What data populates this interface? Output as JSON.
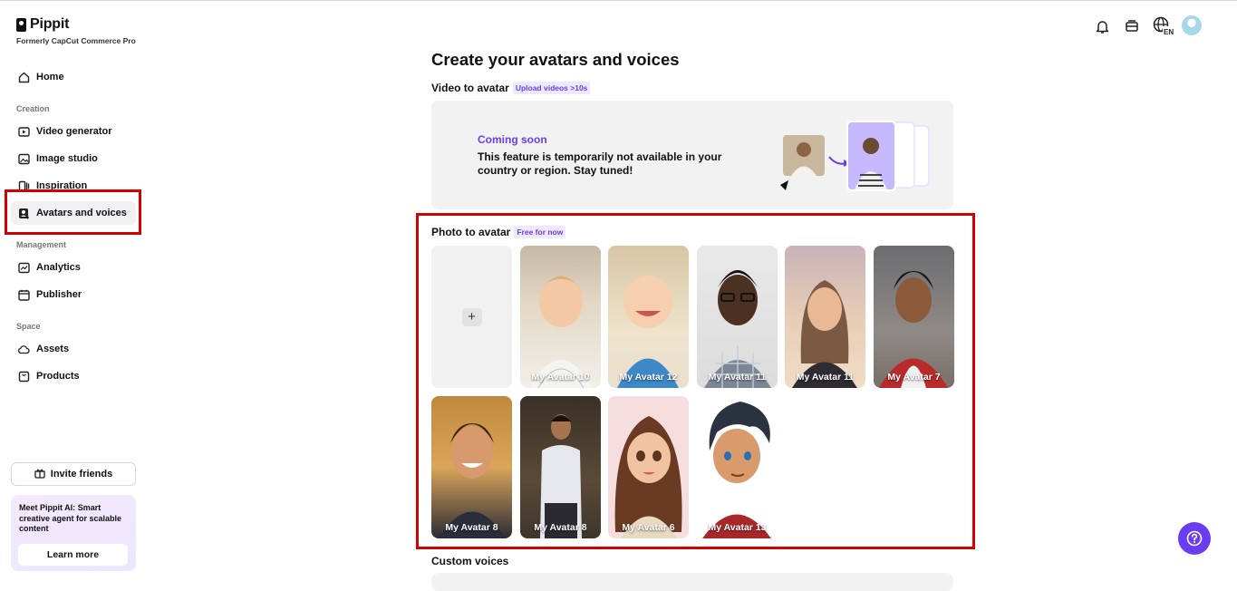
{
  "brand": {
    "name": "Pippit",
    "subtitle": "Formerly CapCut Commerce Pro"
  },
  "sidebar": {
    "home": "Home",
    "creation_label": "Creation",
    "creation_items": [
      "Video generator",
      "Image studio",
      "Inspiration",
      "Avatars and voices"
    ],
    "management_label": "Management",
    "management_items": [
      "Analytics",
      "Publisher"
    ],
    "space_label": "Space",
    "space_items": [
      "Assets",
      "Products"
    ],
    "active_item": "Avatars and voices",
    "invite_label": "Invite friends",
    "promo": {
      "title": "Meet Pippit AI:",
      "text": "Smart creative agent for scalable content",
      "button": "Learn more"
    }
  },
  "header": {
    "language_badge": "EN"
  },
  "page": {
    "title": "Create your avatars and voices",
    "video_to_avatar": {
      "title": "Video to avatar",
      "tag": "Upload videos >10s",
      "status": "Coming soon",
      "message": "This feature is temporarily not available in your country or region. Stay tuned!"
    },
    "photo_to_avatar": {
      "title": "Photo to avatar",
      "tag": "Free for now",
      "add_label": "+",
      "avatars": [
        {
          "name": "My Avatar 10"
        },
        {
          "name": "My Avatar 12"
        },
        {
          "name": "My Avatar 11"
        },
        {
          "name": "My Avatar 11"
        },
        {
          "name": "My Avatar 7"
        },
        {
          "name": "My Avatar 8"
        },
        {
          "name": "My Avatar 8"
        },
        {
          "name": "My Avatar 6"
        },
        {
          "name": "My Avatar 13"
        }
      ]
    },
    "custom_voices": {
      "title": "Custom voices"
    }
  },
  "colors": {
    "accent": "#6a3df0",
    "highlight_border": "#d40000"
  }
}
